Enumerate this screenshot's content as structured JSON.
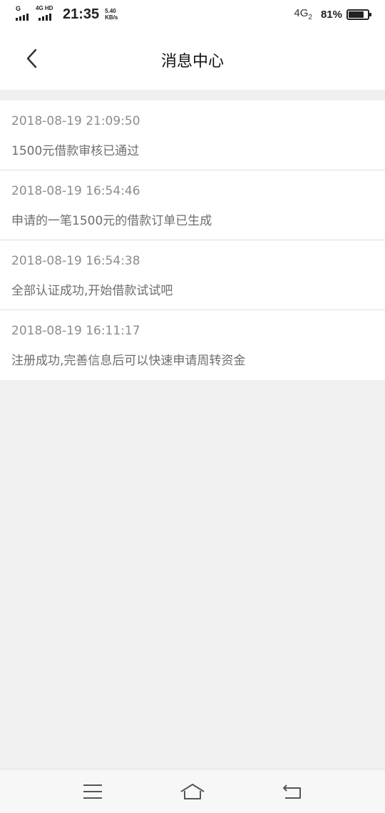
{
  "status_bar": {
    "sim1_label": "G",
    "sim2_label": "4G HD",
    "time": "21:35",
    "speed_value": "5.40",
    "speed_unit": "KB/s",
    "network": "4G",
    "network_sim": "2",
    "battery_percent": "81%",
    "battery_level": 0.81
  },
  "header": {
    "title": "消息中心",
    "back_icon": "chevron-left-icon"
  },
  "messages": [
    {
      "time": "2018-08-19 21:09:50",
      "text": "1500元借款审核已通过"
    },
    {
      "time": "2018-08-19 16:54:46",
      "text": "申请的一笔1500元的借款订单已生成"
    },
    {
      "time": "2018-08-19 16:54:38",
      "text": "全部认证成功,开始借款试试吧"
    },
    {
      "time": "2018-08-19 16:11:17",
      "text": "注册成功,完善信息后可以快速申请周转资金"
    }
  ],
  "bottom_nav": {
    "menu_icon": "menu-icon",
    "home_icon": "home-icon",
    "back_icon": "return-icon"
  },
  "colors": {
    "background": "#f0f0f0",
    "card": "#ffffff",
    "time_text": "#8c8c8c",
    "message_text": "#6e6e6e"
  }
}
